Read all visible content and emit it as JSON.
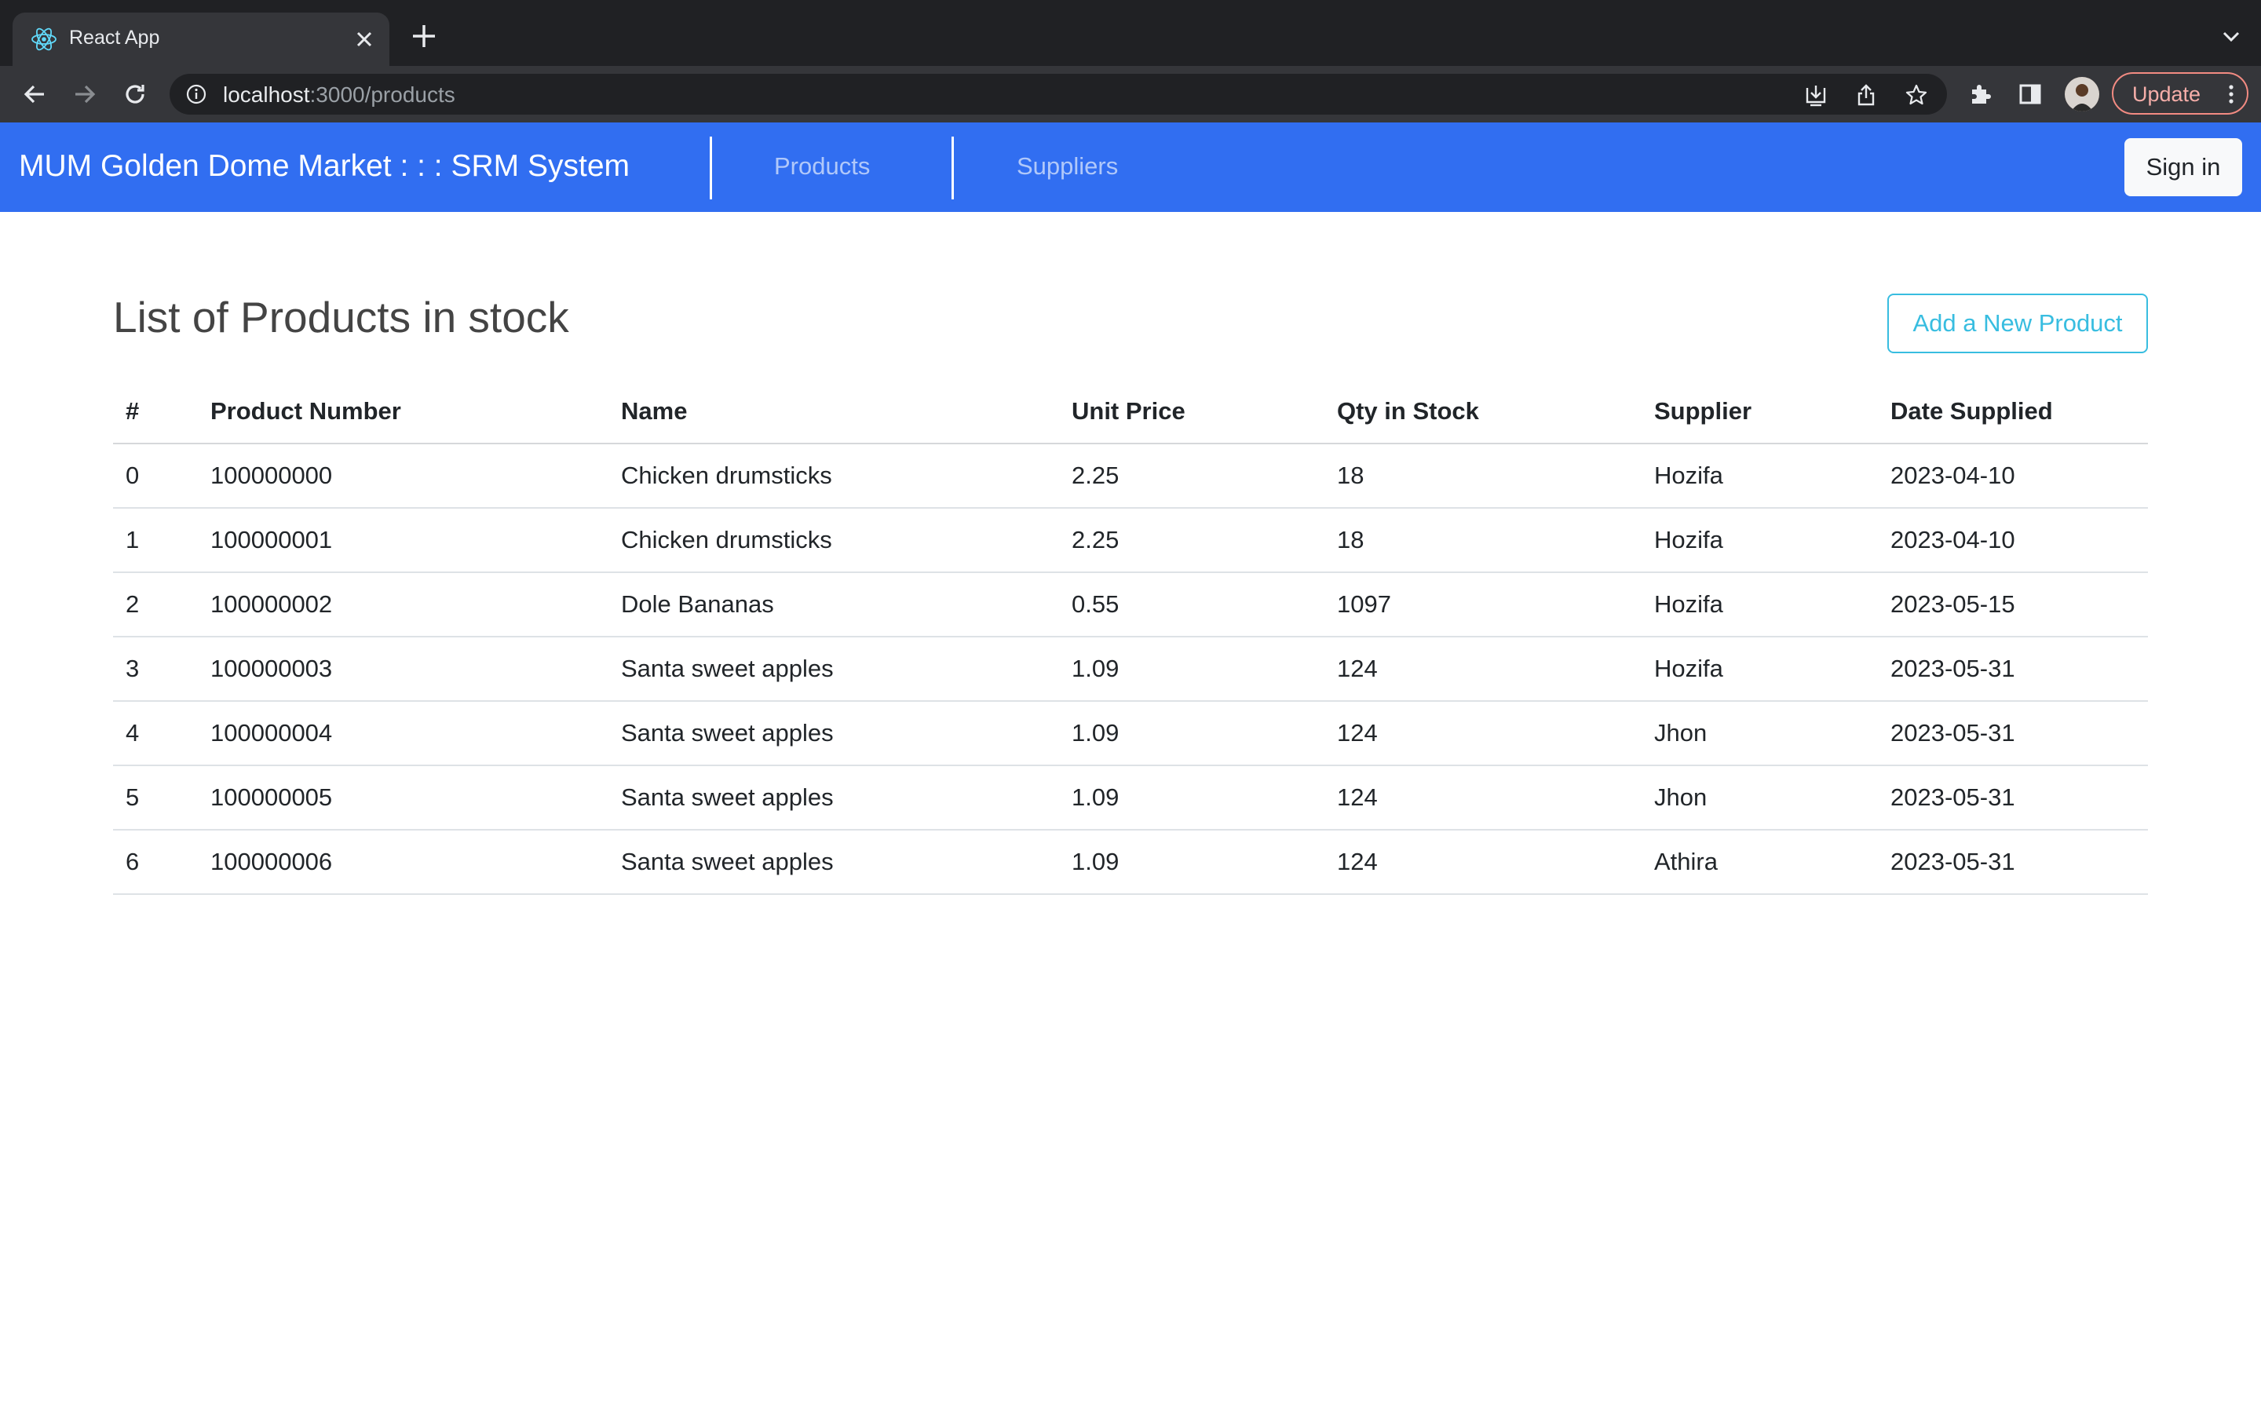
{
  "browser": {
    "tab_title": "React App",
    "url_host": "localhost",
    "url_path": ":3000/products",
    "update_label": "Update"
  },
  "navbar": {
    "brand": "MUM Golden Dome Market : : : SRM System",
    "links": [
      "Products",
      "Suppliers"
    ],
    "signin_label": "Sign in",
    "color": "#316ef1"
  },
  "page": {
    "title": "List of Products in stock",
    "add_button_label": "Add a New Product",
    "accent": "#38bde0"
  },
  "table": {
    "headers": [
      "#",
      "Product Number",
      "Name",
      "Unit Price",
      "Qty in Stock",
      "Supplier",
      "Date Supplied"
    ],
    "rows": [
      [
        "0",
        "100000000",
        "Chicken drumsticks",
        "2.25",
        "18",
        "Hozifa",
        "2023-04-10"
      ],
      [
        "1",
        "100000001",
        "Chicken drumsticks",
        "2.25",
        "18",
        "Hozifa",
        "2023-04-10"
      ],
      [
        "2",
        "100000002",
        "Dole Bananas",
        "0.55",
        "1097",
        "Hozifa",
        "2023-05-15"
      ],
      [
        "3",
        "100000003",
        "Santa sweet apples",
        "1.09",
        "124",
        "Hozifa",
        "2023-05-31"
      ],
      [
        "4",
        "100000004",
        "Santa sweet apples",
        "1.09",
        "124",
        "Jhon",
        "2023-05-31"
      ],
      [
        "5",
        "100000005",
        "Santa sweet apples",
        "1.09",
        "124",
        "Jhon",
        "2023-05-31"
      ],
      [
        "6",
        "100000006",
        "Santa sweet apples",
        "1.09",
        "124",
        "Athira",
        "2023-05-31"
      ]
    ]
  }
}
